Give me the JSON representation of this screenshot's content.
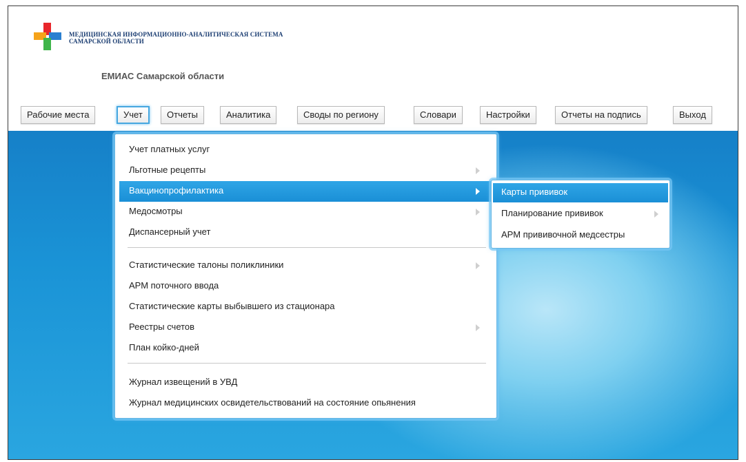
{
  "header": {
    "logo_line1": "МЕДИЦИНСКАЯ ИНФОРМАЦИОННО-АНАЛИТИЧЕСКАЯ СИСТЕМА",
    "logo_line2": "САМАРСКОЙ ОБЛАСТИ",
    "app_title": "ЕМИАС Самарской области",
    "logo_icon": "medical-cross-logo"
  },
  "nav": {
    "items": [
      {
        "label": "Рабочие места"
      },
      {
        "label": "Учет",
        "active": true
      },
      {
        "label": "Отчеты"
      },
      {
        "label": "Аналитика"
      },
      {
        "label": "Своды по региону"
      },
      {
        "label": "Словари"
      },
      {
        "label": "Настройки"
      },
      {
        "label": "Отчеты на подпись"
      },
      {
        "label": "Выход"
      }
    ]
  },
  "menu": {
    "items": [
      {
        "label": "Учет платных услуг",
        "has_submenu": false
      },
      {
        "label": "Льготные рецепты",
        "has_submenu": true
      },
      {
        "label": "Вакцинопрофилактика",
        "has_submenu": true,
        "highlighted": true
      },
      {
        "label": "Медосмотры",
        "has_submenu": true
      },
      {
        "label": "Диспансерный учет",
        "has_submenu": false
      },
      {
        "label": "Статистические талоны поликлиники",
        "has_submenu": true
      },
      {
        "label": "АРМ поточного ввода",
        "has_submenu": false
      },
      {
        "label": "Статистические карты выбывшего из стационара",
        "has_submenu": false
      },
      {
        "label": "Реестры счетов",
        "has_submenu": true
      },
      {
        "label": "План койко-дней",
        "has_submenu": false
      },
      {
        "label": "Журнал извещений в УВД",
        "has_submenu": false
      },
      {
        "label": "Журнал медицинских освидетельствований на состояние опьянения",
        "has_submenu": false
      }
    ]
  },
  "submenu": {
    "items": [
      {
        "label": "Карты прививок",
        "highlighted": true
      },
      {
        "label": "Планирование прививок",
        "has_submenu": true
      },
      {
        "label": "АРМ прививочной медсестры"
      }
    ]
  },
  "colors": {
    "accent": "#1a8fd6",
    "background_blue": "#1a93d6",
    "logo_red": "#e8262b",
    "logo_orange": "#f5a31a",
    "logo_blue": "#2a7fd0",
    "logo_green": "#3fb54a"
  }
}
